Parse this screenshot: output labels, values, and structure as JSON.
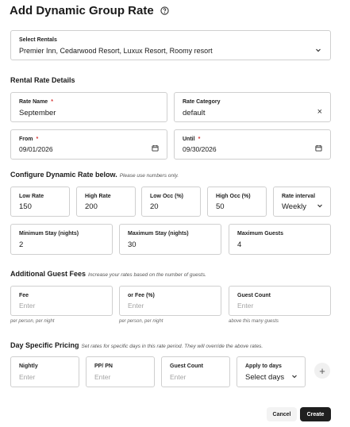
{
  "header": {
    "title": "Add Dynamic Group Rate",
    "help_icon": "help-circle-icon"
  },
  "select_rentals": {
    "label": "Select Rentals",
    "value": "Premier Inn, Cedarwood Resort, Luxux Resort, Roomy resort"
  },
  "rental_rate_details": {
    "heading": "Rental Rate Details",
    "rate_name": {
      "label": "Rate Name",
      "required": "*",
      "value": "September"
    },
    "rate_category": {
      "label": "Rate Category",
      "value": "default",
      "clear": "×"
    },
    "from": {
      "label": "From",
      "required": "*",
      "value": "09/01/2026"
    },
    "until": {
      "label": "Until",
      "required": "*",
      "value": "09/30/2026"
    }
  },
  "dynamic_rate": {
    "heading": "Configure Dynamic Rate below.",
    "hint": "Please use numbers only.",
    "low_rate": {
      "label": "Low Rate",
      "value": "150"
    },
    "high_rate": {
      "label": "High Rate",
      "value": "200"
    },
    "low_occ": {
      "label": "Low Occ (%)",
      "value": "20"
    },
    "high_occ": {
      "label": "High Occ (%)",
      "value": "50"
    },
    "rate_interval": {
      "label": "Rate interval",
      "value": "Weekly"
    },
    "min_stay": {
      "label": "Minimum Stay (nights)",
      "value": "2"
    },
    "max_stay": {
      "label": "Maximum Stay (nights)",
      "value": "30"
    },
    "max_guests": {
      "label": "Maximum Guests",
      "value": "4"
    }
  },
  "guest_fees": {
    "heading": "Additional Guest Fees",
    "hint": "Increase your rates based on the number of guests.",
    "fee": {
      "label": "Fee",
      "placeholder": "Enter",
      "helper": "per person, per night"
    },
    "or_fee": {
      "label": "or Fee (%)",
      "placeholder": "Enter",
      "helper": "per person, per night"
    },
    "guest_count": {
      "label": "Guest Count",
      "placeholder": "Enter",
      "helper": "above this many guests"
    }
  },
  "day_pricing": {
    "heading": "Day Specific Pricing",
    "hint": "Set rates for specific days in this rate period. They will override the above rates.",
    "nightly": {
      "label": "Nightly",
      "placeholder": "Enter"
    },
    "pp_pn": {
      "label": "PP/ PN",
      "placeholder": "Enter"
    },
    "guest_count": {
      "label": "Guest Count",
      "placeholder": "Enter"
    },
    "apply_days": {
      "label": "Apply to days",
      "value": "Select days"
    },
    "add": "+"
  },
  "footer": {
    "cancel": "Cancel",
    "create": "Create"
  },
  "colors": {
    "primary_button": "#1f1f1f",
    "required": "#d63333",
    "border": "#cfcfcf"
  }
}
